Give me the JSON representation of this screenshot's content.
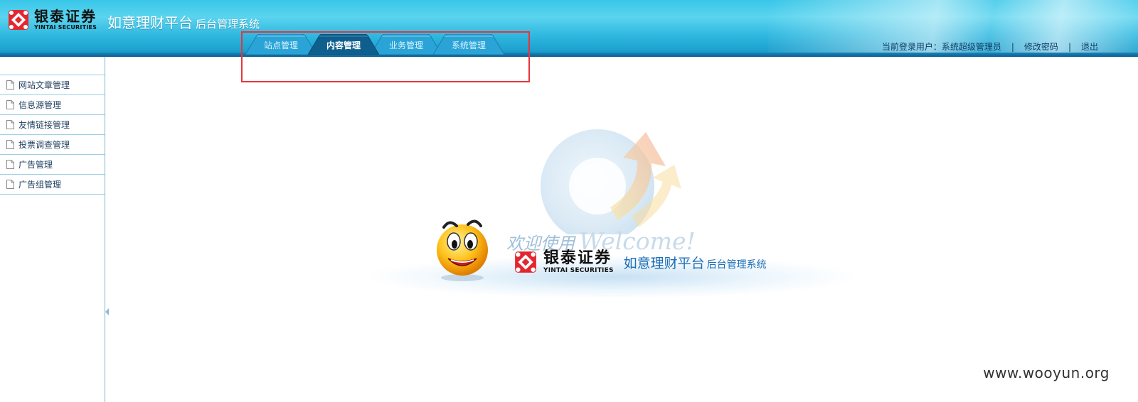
{
  "brand": {
    "logo_cn": "银泰证券",
    "logo_en": "YINTAI SECURITIES",
    "logo_color": "#e3262f"
  },
  "app": {
    "title_main": "如意理财平台",
    "title_sub": "后台管理系统"
  },
  "nav": {
    "tabs": [
      {
        "label": "站点管理",
        "active": false
      },
      {
        "label": "内容管理",
        "active": true
      },
      {
        "label": "业务管理",
        "active": false
      },
      {
        "label": "系统管理",
        "active": false
      }
    ]
  },
  "user": {
    "current_user_text": "当前登录用户：系统超级管理员",
    "separator": "|",
    "change_password": "修改密码",
    "logout": "退出"
  },
  "sidebar": {
    "items": [
      {
        "label": "网站文章管理",
        "icon": "document-icon"
      },
      {
        "label": "信息源管理",
        "icon": "document-icon"
      },
      {
        "label": "友情链接管理",
        "icon": "document-icon"
      },
      {
        "label": "投票调查管理",
        "icon": "document-icon"
      },
      {
        "label": "广告管理",
        "icon": "document-icon"
      },
      {
        "label": "广告组管理",
        "icon": "document-icon"
      }
    ]
  },
  "welcome": {
    "text_cn": "欢迎使用",
    "text_en": "Welcome!",
    "logo_cn": "银泰证券",
    "logo_en": "YINTAI SECURITIES",
    "app_main": "如意理财平台",
    "app_sub": "后台管理系统"
  },
  "watermark": "www.wooyun.org",
  "colors": {
    "header_top": "#38c6e8",
    "header_bottom": "#1596c6",
    "tab_active": "#0e5f8e",
    "highlight_box": "#e8343c",
    "sidebar_border": "#9fcfe6"
  }
}
